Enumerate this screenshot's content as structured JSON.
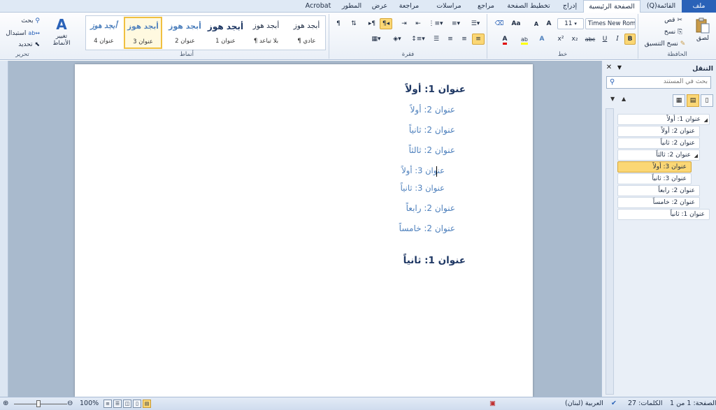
{
  "tabs": [
    {
      "id": "file",
      "label": "ملف"
    },
    {
      "id": "menu",
      "label": "(Q)القائمة"
    },
    {
      "id": "home",
      "label": "الصفحة الرئيسية"
    },
    {
      "id": "insert",
      "label": "إدراج"
    },
    {
      "id": "layout",
      "label": "تخطيط الصفحة"
    },
    {
      "id": "references",
      "label": "مراجع"
    },
    {
      "id": "mailings",
      "label": "مراسلات"
    },
    {
      "id": "review",
      "label": "مراجعة"
    },
    {
      "id": "view",
      "label": "عرض"
    },
    {
      "id": "developer",
      "label": "المطور"
    },
    {
      "id": "acrobat",
      "label": "Acrobat"
    }
  ],
  "ribbon": {
    "clipboard": {
      "label": "الحافظة",
      "paste": "لصق",
      "cut": "قص",
      "copy": "نسخ",
      "format_painter": "نسخ التنسيق"
    },
    "font": {
      "label": "خط",
      "font_name": "Times New Roma",
      "font_size": "11",
      "bold": "B",
      "italic": "I",
      "underline": "U",
      "strike": "abc",
      "subscript": "x₂",
      "superscript": "x²",
      "grow": "A",
      "shrink": "A",
      "change_case": "Aa",
      "font_color": "A",
      "highlight": "ab",
      "text_effects": "A"
    },
    "paragraph": {
      "label": "فقرة"
    },
    "styles": {
      "label": "أنماط",
      "items": [
        {
          "sample": "أبجد هوز",
          "name": "¶ عادي"
        },
        {
          "sample": "أبجد هوز",
          "name": "¶ بلا تباعد"
        },
        {
          "sample": "أبجد هوز",
          "name": "عنوان 1"
        },
        {
          "sample": "أبجد هوز",
          "name": "عنوان 2"
        },
        {
          "sample": "أبجد هوز",
          "name": "عنوان 3"
        },
        {
          "sample": "أبجد هوز",
          "name": "عنوان 4"
        }
      ],
      "change_styles": "تغيير الأنماط"
    },
    "editing": {
      "label": "تحرير",
      "find": "بحث",
      "replace": "استبدال",
      "select": "تحديد"
    }
  },
  "document": {
    "lines": [
      {
        "text": "عنوان 1: أولاً",
        "level": 1
      },
      {
        "text": "عنوان 2: أولاً",
        "level": 2
      },
      {
        "text": "عنوان 2: ثانياً",
        "level": 2
      },
      {
        "text": "عنوان 2: ثالثاً",
        "level": 2
      },
      {
        "text": "عنوان 3: أولاً",
        "level": 3
      },
      {
        "text": "عنوان 3: ثانياً",
        "level": 3
      },
      {
        "text": "عنوان 2: رابعاً",
        "level": 2
      },
      {
        "text": "عنوان 2: خامساً",
        "level": 2
      },
      {
        "text": "عنوان 1: ثانياً",
        "level": 1
      }
    ]
  },
  "nav_pane": {
    "title": "التنقل",
    "search_placeholder": "بحث في المستند",
    "items": [
      {
        "text": "عنوان 1: أولاً",
        "selected": false
      },
      {
        "text": "عنوان 2: أولاً",
        "selected": false
      },
      {
        "text": "عنوان 2: ثانياً",
        "selected": false
      },
      {
        "text": "عنوان 2: ثالثاً",
        "selected": false
      },
      {
        "text": "عنوان 3: أولاً",
        "selected": true
      },
      {
        "text": "عنوان 3: ثانياً",
        "selected": false
      },
      {
        "text": "عنوان 2: رابعاً",
        "selected": false
      },
      {
        "text": "عنوان 2: خامساً",
        "selected": false
      },
      {
        "text": "عنوان 1: ثانياً",
        "selected": false
      }
    ]
  },
  "status_bar": {
    "page": "الصفحة: 1 من 1",
    "words": "الكلمات: 27",
    "language": "العربية (لبنان)",
    "zoom": "100%"
  },
  "colors": {
    "heading1": "#1f3864",
    "heading2": "#4f81bd",
    "accent": "#fbd775",
    "file_tab": "#2a62b8"
  }
}
